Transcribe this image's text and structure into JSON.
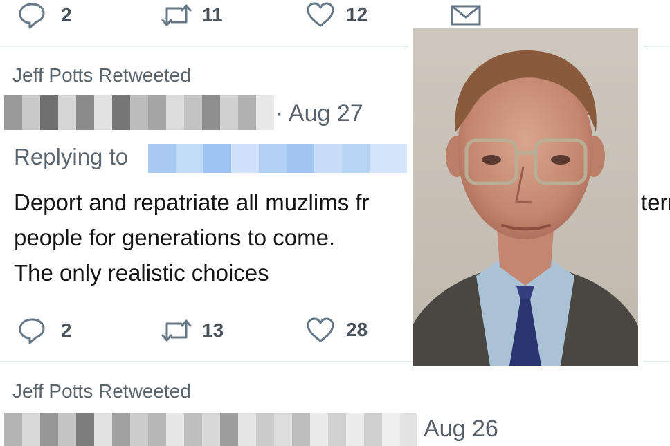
{
  "top_actions": {
    "replies": "2",
    "retweets": "11",
    "likes": "12"
  },
  "tweet1": {
    "retweeted_by": "Jeff Potts Retweeted",
    "date": "· Aug 27",
    "replying_to": "Replying to",
    "text_lines": [
      "Deport and repatriate all muzlims fr",
      "people for generations to come.",
      "The only realistic choices"
    ],
    "text_right_fragment": "tern",
    "actions": {
      "replies": "2",
      "retweets": "13",
      "likes": "28"
    }
  },
  "tweet2": {
    "retweeted_by": "Jeff Potts Retweeted",
    "date": "Aug 26"
  },
  "colors": {
    "icon_gray": "#657786",
    "divider": "#e6ecf0",
    "mention_blue": "#b3d1f3"
  }
}
